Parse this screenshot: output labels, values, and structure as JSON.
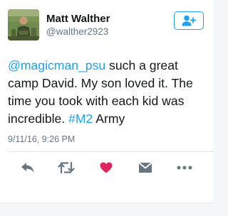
{
  "author": {
    "display_name": "Matt Walther",
    "handle": "@walther2923"
  },
  "follow_button": {
    "icon": "add-user-icon"
  },
  "tweet": {
    "mention": "@magicman_psu",
    "text_part1": " such a great camp David. My son loved it.  The time you took with each kid was incredible.  ",
    "hashtag": "#M2",
    "text_part2": " Army",
    "timestamp": "9/11/16, 9:26 PM"
  },
  "actions": [
    {
      "name": "reply",
      "icon": "reply-icon"
    },
    {
      "name": "retweet",
      "icon": "retweet-icon"
    },
    {
      "name": "like",
      "icon": "heart-icon"
    },
    {
      "name": "message",
      "icon": "envelope-icon"
    },
    {
      "name": "more",
      "icon": "more-icon"
    }
  ],
  "colors": {
    "accent": "#1da1f2",
    "like": "#e0245e",
    "muted": "#657786",
    "icon_gray": "#66757f"
  }
}
